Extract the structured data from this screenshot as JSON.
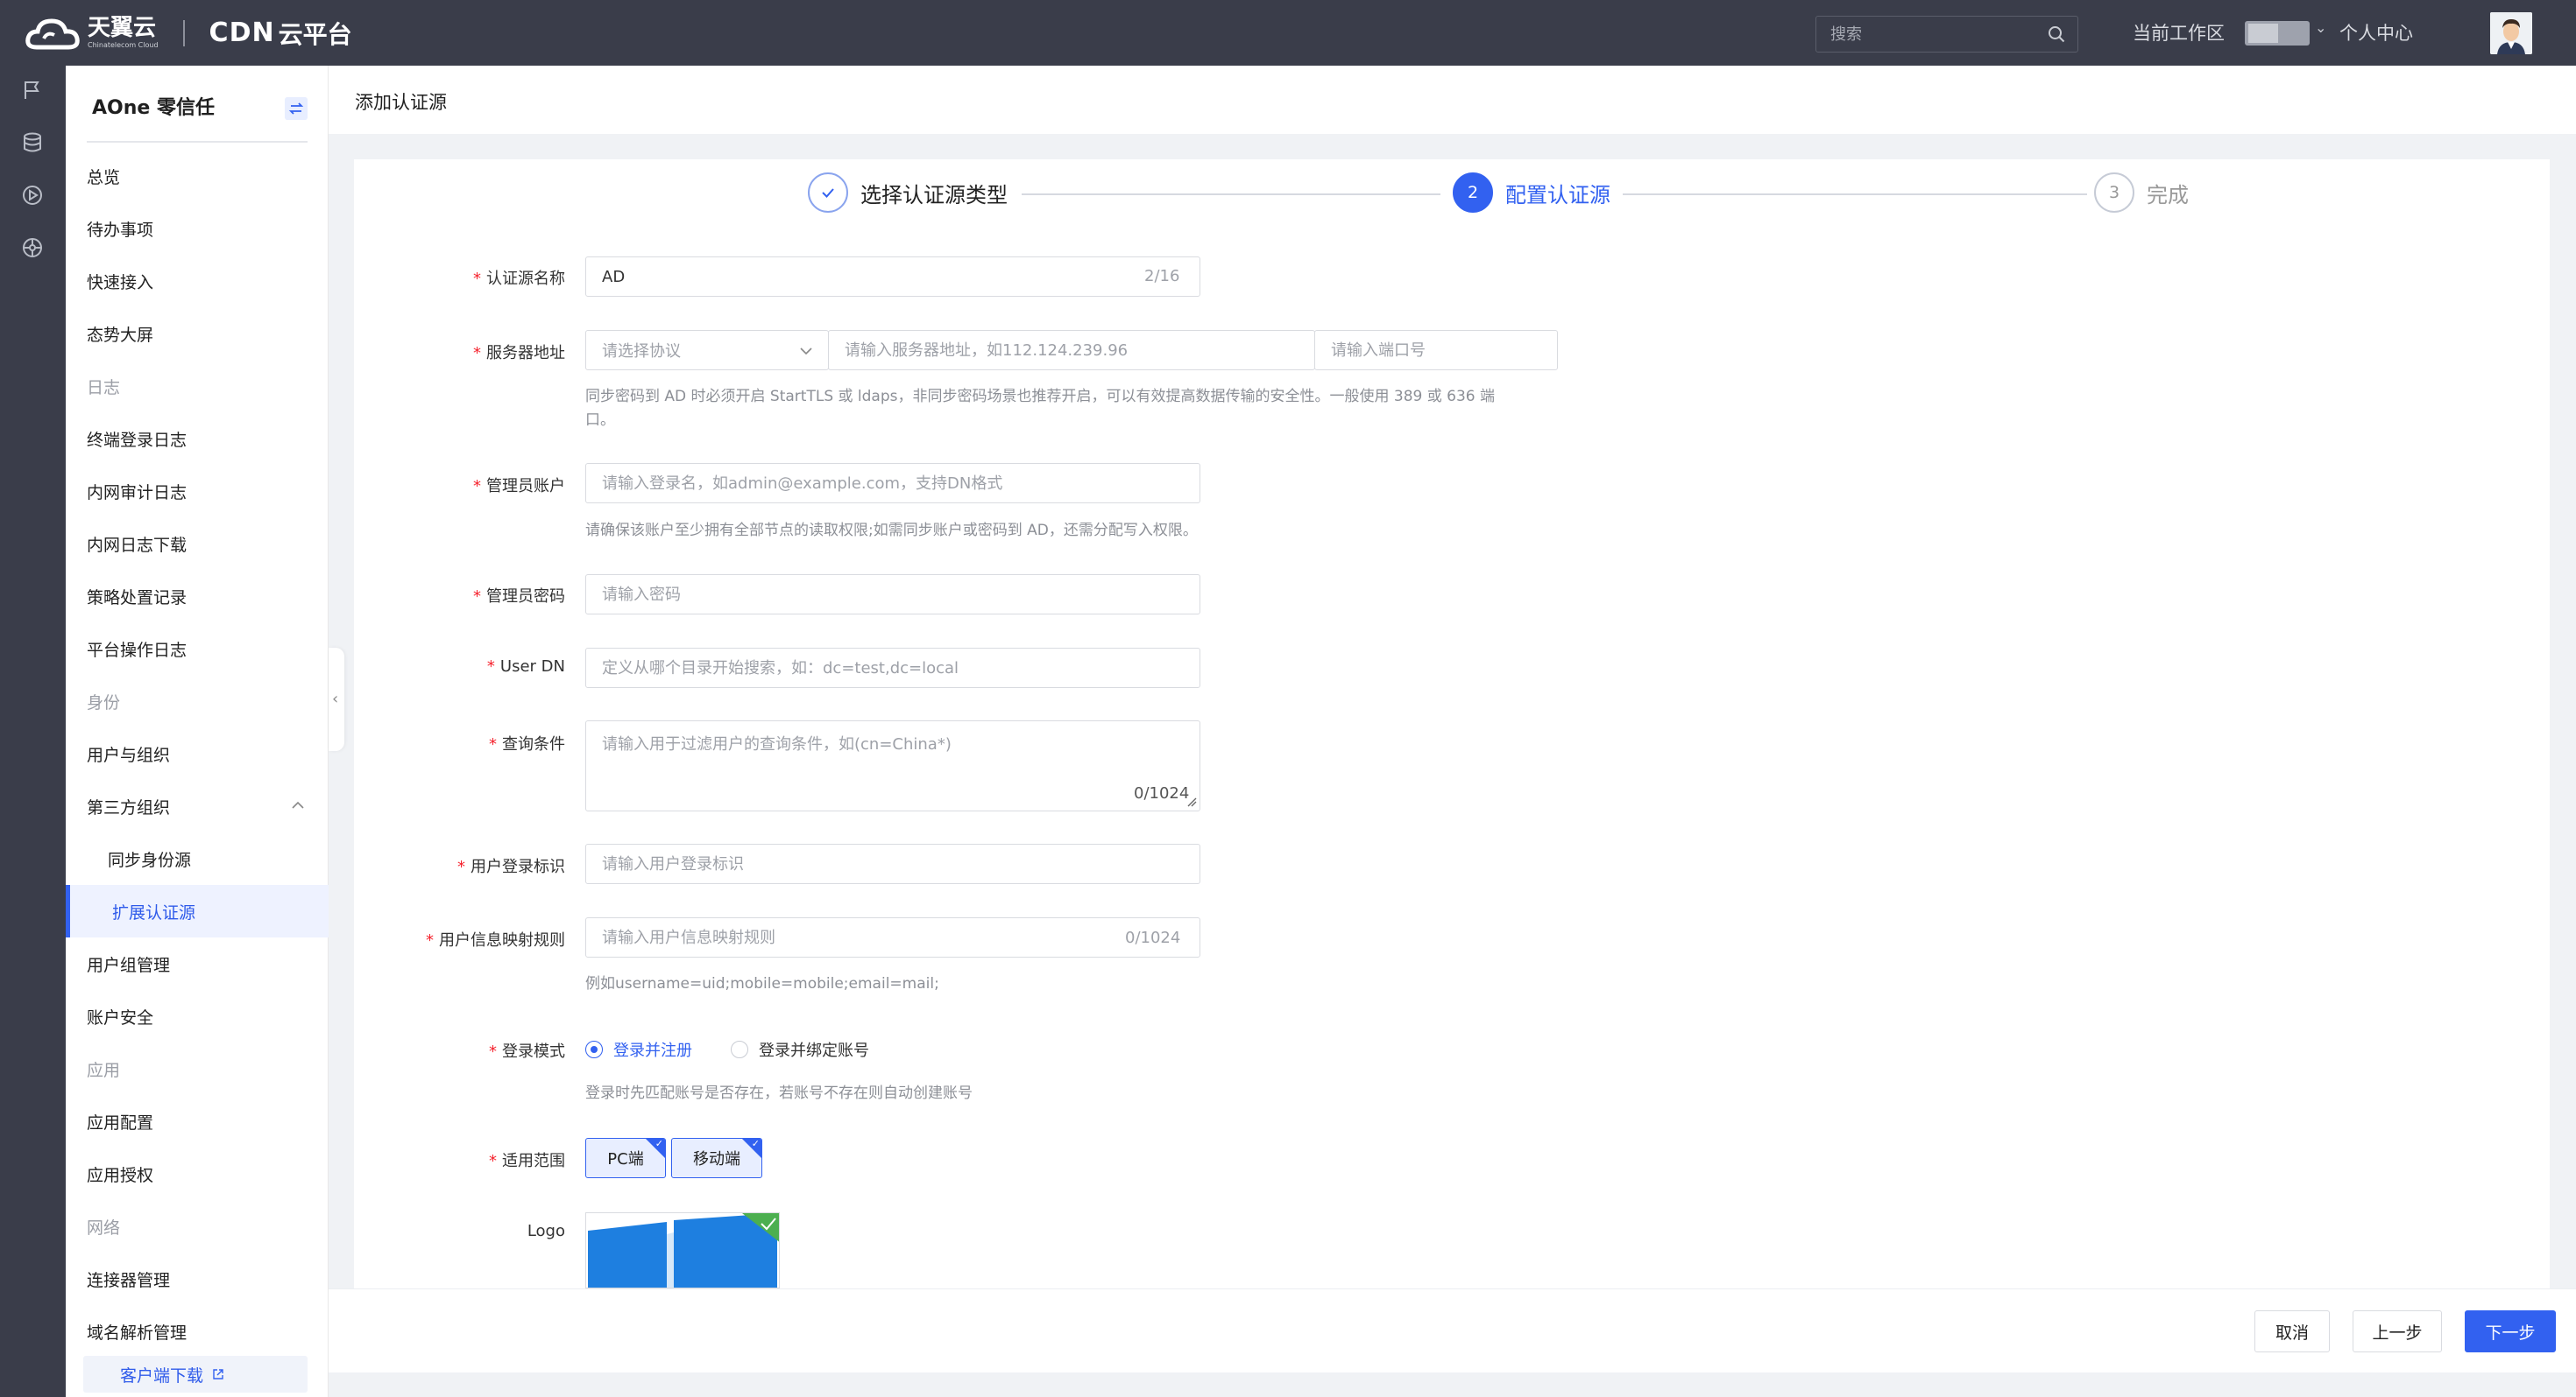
{
  "topbar": {
    "brand": "天翼云",
    "brand_sub": "Chinatelecom Cloud",
    "product_cdn": "CDN",
    "product_name": "云平台",
    "search_placeholder": "搜索",
    "workspace_label": "当前工作区",
    "personal_center": "个人中心"
  },
  "rail": {
    "icons": [
      "flag-icon",
      "database-icon",
      "play-circle-icon",
      "dashboard-icon"
    ]
  },
  "sidebar": {
    "title": "AOne 零信任",
    "items": [
      {
        "label": "总览",
        "kind": "item"
      },
      {
        "label": "待办事项",
        "kind": "item"
      },
      {
        "label": "快速接入",
        "kind": "item"
      },
      {
        "label": "态势大屏",
        "kind": "item"
      },
      {
        "label": "日志",
        "kind": "group"
      },
      {
        "label": "终端登录日志",
        "kind": "item"
      },
      {
        "label": "内网审计日志",
        "kind": "item"
      },
      {
        "label": "内网日志下载",
        "kind": "item"
      },
      {
        "label": "策略处置记录",
        "kind": "item"
      },
      {
        "label": "平台操作日志",
        "kind": "item"
      },
      {
        "label": "身份",
        "kind": "group"
      },
      {
        "label": "用户与组织",
        "kind": "item"
      },
      {
        "label": "第三方组织",
        "kind": "item"
      },
      {
        "label": "同步身份源",
        "kind": "sub"
      },
      {
        "label": "扩展认证源",
        "kind": "active"
      },
      {
        "label": "用户组管理",
        "kind": "item"
      },
      {
        "label": "账户安全",
        "kind": "item"
      },
      {
        "label": "应用",
        "kind": "group"
      },
      {
        "label": "应用配置",
        "kind": "item"
      },
      {
        "label": "应用授权",
        "kind": "item"
      },
      {
        "label": "网络",
        "kind": "group"
      },
      {
        "label": "连接器管理",
        "kind": "item"
      },
      {
        "label": "域名解析管理",
        "kind": "item"
      }
    ],
    "download": "客户端下载"
  },
  "page": {
    "title": "添加认证源"
  },
  "steps": [
    {
      "number": "✓",
      "label": "选择认证源类型",
      "state": "done"
    },
    {
      "number": "2",
      "label": "配置认证源",
      "state": "active"
    },
    {
      "number": "3",
      "label": "完成",
      "state": "pending"
    }
  ],
  "form": {
    "name": {
      "label": "认证源名称",
      "value": "AD",
      "count": "2/16"
    },
    "server": {
      "label": "服务器地址",
      "protocol_placeholder": "请选择协议",
      "address_placeholder": "请输入服务器地址，如112.124.239.96",
      "port_placeholder": "请输入端口号",
      "help_line1": "同步密码到 AD 时必须开启 StartTLS 或 ldaps，非同步密码场景也推荐开启，可以有效提高数据传输的安全性。一般使用 389 或 636 端",
      "help_line2": "口。"
    },
    "admin_account": {
      "label": "管理员账户",
      "placeholder": "请输入登录名，如admin@example.com，支持DN格式",
      "help": "请确保该账户至少拥有全部节点的读取权限;如需同步账户或密码到 AD，还需分配写入权限。"
    },
    "admin_password": {
      "label": "管理员密码",
      "placeholder": "请输入密码"
    },
    "user_dn": {
      "label": "User DN",
      "placeholder": "定义从哪个目录开始搜索，如：dc=test,dc=local"
    },
    "query": {
      "label": "查询条件",
      "placeholder": "请输入用于过滤用户的查询条件，如(cn=China*)",
      "count": "0/1024"
    },
    "login_id": {
      "label": "用户登录标识",
      "placeholder": "请输入用户登录标识"
    },
    "mapping": {
      "label": "用户信息映射规则",
      "placeholder": "请输入用户信息映射规则",
      "count": "0/1024",
      "help": "例如username=uid;mobile=mobile;email=mail;"
    },
    "login_mode": {
      "label": "登录模式",
      "option1": "登录并注册",
      "option2": "登录并绑定账号",
      "selected": "登录并注册",
      "help": "登录时先匹配账号是否存在，若账号不存在则自动创建账号"
    },
    "scope": {
      "label": "适用范围",
      "option1": "PC端",
      "option2": "移动端"
    },
    "logo": {
      "label": "Logo"
    }
  },
  "footer": {
    "cancel": "取消",
    "prev": "上一步",
    "next": "下一步"
  },
  "colors": {
    "primary": "#3261f0",
    "topbar": "#3a3d4a",
    "required": "#f5222d",
    "page_bg": "#f0f2f5"
  }
}
